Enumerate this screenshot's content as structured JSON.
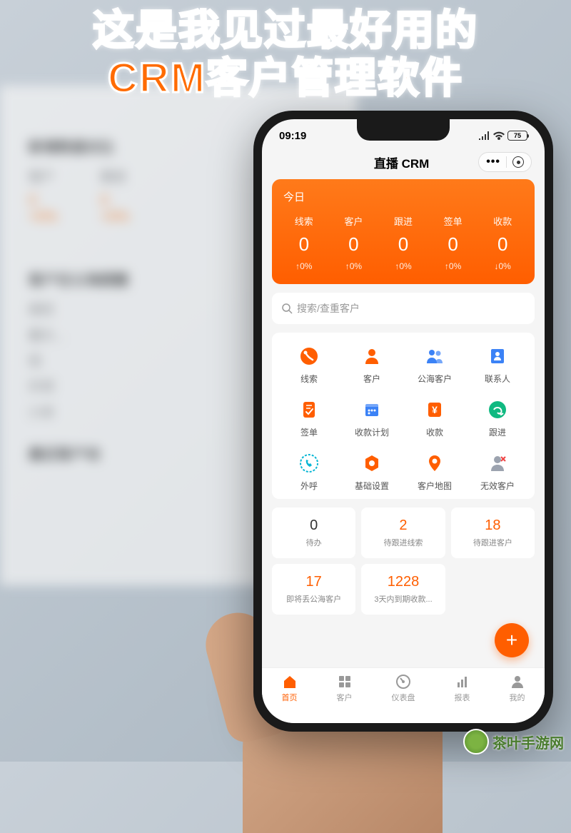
{
  "overlay": {
    "line1": "这是我见过最好用的",
    "line2": "CRM客户管理软件"
  },
  "bg": {
    "section1": "新增数据对比",
    "col1_label": "客户",
    "col1_val": "0",
    "col1_delta": "+0%",
    "col2_label": "跟进",
    "col2_val": "0",
    "col2_delta": "+0%",
    "section2": "客户在公海提醒",
    "items": [
      "高优",
      "最大...",
      "低",
      "外贸",
      "小本"
    ],
    "section3": "最近客户动"
  },
  "status": {
    "time": "09:19",
    "battery": "75"
  },
  "nav": {
    "title": "直播 CRM"
  },
  "stats": {
    "today": "今日",
    "items": [
      {
        "label": "线索",
        "value": "0",
        "delta": "↑0%"
      },
      {
        "label": "客户",
        "value": "0",
        "delta": "↑0%"
      },
      {
        "label": "跟进",
        "value": "0",
        "delta": "↑0%"
      },
      {
        "label": "签单",
        "value": "0",
        "delta": "↑0%"
      },
      {
        "label": "收款",
        "value": "0",
        "delta": "↓0%"
      }
    ]
  },
  "search": {
    "placeholder": "搜索/查重客户"
  },
  "apps": [
    {
      "label": "线索",
      "icon": "lead-icon",
      "color": "#ff5e00"
    },
    {
      "label": "客户",
      "icon": "customer-icon",
      "color": "#ff5e00"
    },
    {
      "label": "公海客户",
      "icon": "public-customer-icon",
      "color": "#3b82f6"
    },
    {
      "label": "联系人",
      "icon": "contact-icon",
      "color": "#3b82f6"
    },
    {
      "label": "签单",
      "icon": "contract-icon",
      "color": "#ff5e00"
    },
    {
      "label": "收款计划",
      "icon": "payment-plan-icon",
      "color": "#3b82f6"
    },
    {
      "label": "收款",
      "icon": "payment-icon",
      "color": "#ff5e00"
    },
    {
      "label": "跟进",
      "icon": "followup-icon",
      "color": "#10b981"
    },
    {
      "label": "外呼",
      "icon": "call-icon",
      "color": "#06b6d4"
    },
    {
      "label": "基础设置",
      "icon": "settings-icon",
      "color": "#ff5e00"
    },
    {
      "label": "客户地图",
      "icon": "map-icon",
      "color": "#ff5e00"
    },
    {
      "label": "无效客户",
      "icon": "invalid-icon",
      "color": "#9ca3af"
    }
  ],
  "todos": [
    {
      "num": "0",
      "label": "待办",
      "cls": "black"
    },
    {
      "num": "2",
      "label": "待跟进线索",
      "cls": "orange"
    },
    {
      "num": "18",
      "label": "待跟进客户",
      "cls": "orange"
    },
    {
      "num": "17",
      "label": "即将丢公海客户",
      "cls": "orange"
    },
    {
      "num": "1228",
      "label": "3天内到期收款...",
      "cls": "orange"
    }
  ],
  "tabs": [
    {
      "label": "首页",
      "icon": "home-icon",
      "active": true
    },
    {
      "label": "客户",
      "icon": "grid-icon",
      "active": false
    },
    {
      "label": "仪表盘",
      "icon": "dashboard-icon",
      "active": false
    },
    {
      "label": "报表",
      "icon": "report-icon",
      "active": false
    },
    {
      "label": "我的",
      "icon": "profile-icon",
      "active": false
    }
  ],
  "watermark": "茶叶手游网"
}
